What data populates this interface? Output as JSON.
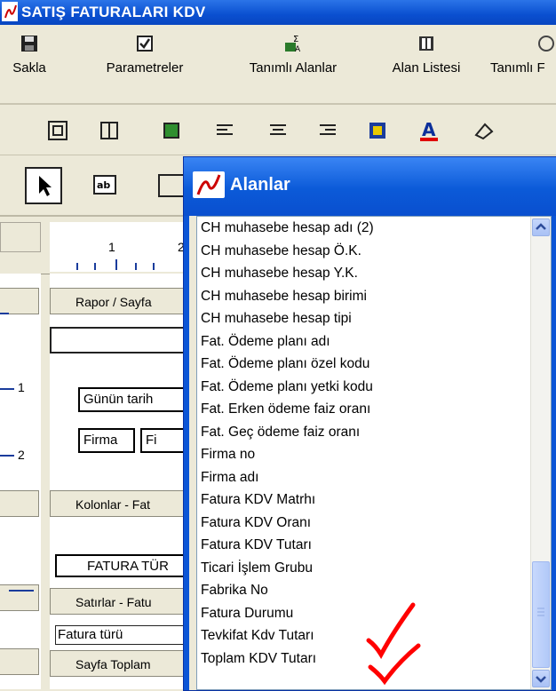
{
  "window": {
    "title": "SATIŞ FATURALARI KDV"
  },
  "toolbar": {
    "save": "Sakla",
    "params": "Parametreler",
    "defined_fields": "Tanımlı Alanlar",
    "field_list": "Alan Listesi",
    "defined_cut": "Tanımlı F"
  },
  "format_toolbar": {
    "icons": [
      "align-grid-icon",
      "size-grid-icon",
      "fill-icon",
      "align-left-icon",
      "align-center-icon",
      "align-right-icon",
      "color-box-icon",
      "font-color-icon",
      "eraser-icon"
    ]
  },
  "ruler": {
    "tick1": "1",
    "tick2": "2"
  },
  "left_markers": {
    "m1": "1",
    "m2": "2"
  },
  "bands": {
    "report_page": "Rapor / Sayfa",
    "columns": "Kolonlar - Fat",
    "rows": "Satırlar - Fatu",
    "page_totals": "Sayfa Toplam"
  },
  "fields": {
    "date": "Günün tarih",
    "firma": "Firma",
    "fi": "Fi",
    "fatura_tur": "FATURA TÜR",
    "fatura_turu": "Fatura türü"
  },
  "dialog": {
    "title": "Alanlar",
    "items": [
      "CH muhasebe hesap adı (2)",
      "CH muhasebe hesap Ö.K.",
      "CH muhasebe hesap Y.K.",
      "CH muhasebe hesap birimi",
      "CH muhasebe hesap tipi",
      "Fat. Ödeme planı adı",
      "Fat. Ödeme planı özel kodu",
      "Fat. Ödeme planı yetki kodu",
      "Fat. Erken ödeme faiz oranı",
      "Fat. Geç ödeme faiz oranı",
      "Firma no",
      "Firma adı",
      "Fatura KDV Matrhı",
      "Fatura KDV Oranı",
      "Fatura KDV Tutarı",
      "Ticari İşlem Grubu",
      "Fabrika No",
      "Fatura Durumu",
      "Tevkifat Kdv Tutarı",
      "Toplam KDV Tutarı"
    ],
    "check_color": "#ff0000"
  }
}
